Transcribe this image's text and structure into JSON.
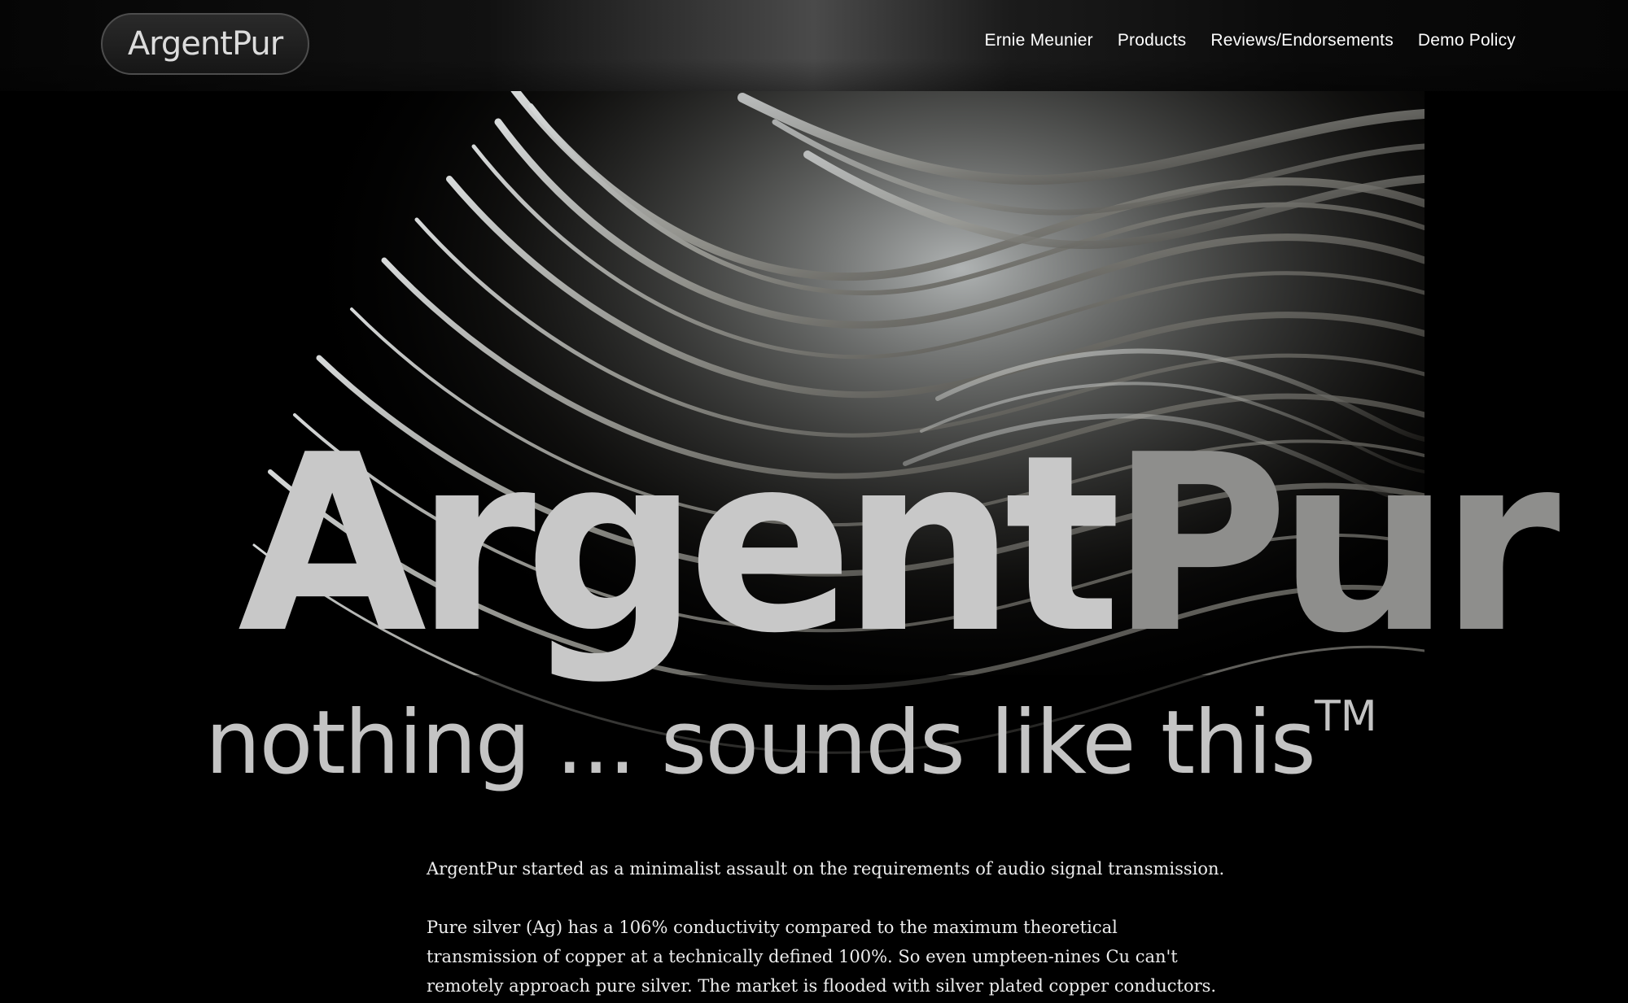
{
  "brand": {
    "logo_text": "ArgentPur"
  },
  "nav": {
    "items": [
      {
        "label": "Ernie Meunier"
      },
      {
        "label": "Products"
      },
      {
        "label": "Reviews/Endorsements"
      },
      {
        "label": "Demo Policy"
      }
    ]
  },
  "hero": {
    "wordmark_part1": "Argent",
    "wordmark_part2": "Pur",
    "tagline": "nothing ... sounds like this",
    "tagline_mark": "TM"
  },
  "body": {
    "paragraph1": "ArgentPur started as a minimalist assault on the requirements of audio signal transmission.",
    "paragraph2_line1": "Pure silver (Ag) has a 106% conductivity compared to the maximum theoretical",
    "paragraph2_line2": "transmission of copper at a technically defined 100%. So even umpteen-nines Cu can't",
    "paragraph2_line3": "remotely approach pure silver. The market is flooded with silver plated copper conductors."
  },
  "colors": {
    "background": "#000000",
    "wordmark_light": "#c8c8c8",
    "wordmark_dark": "#8e8e8c",
    "nav_text": "#ffffff"
  }
}
